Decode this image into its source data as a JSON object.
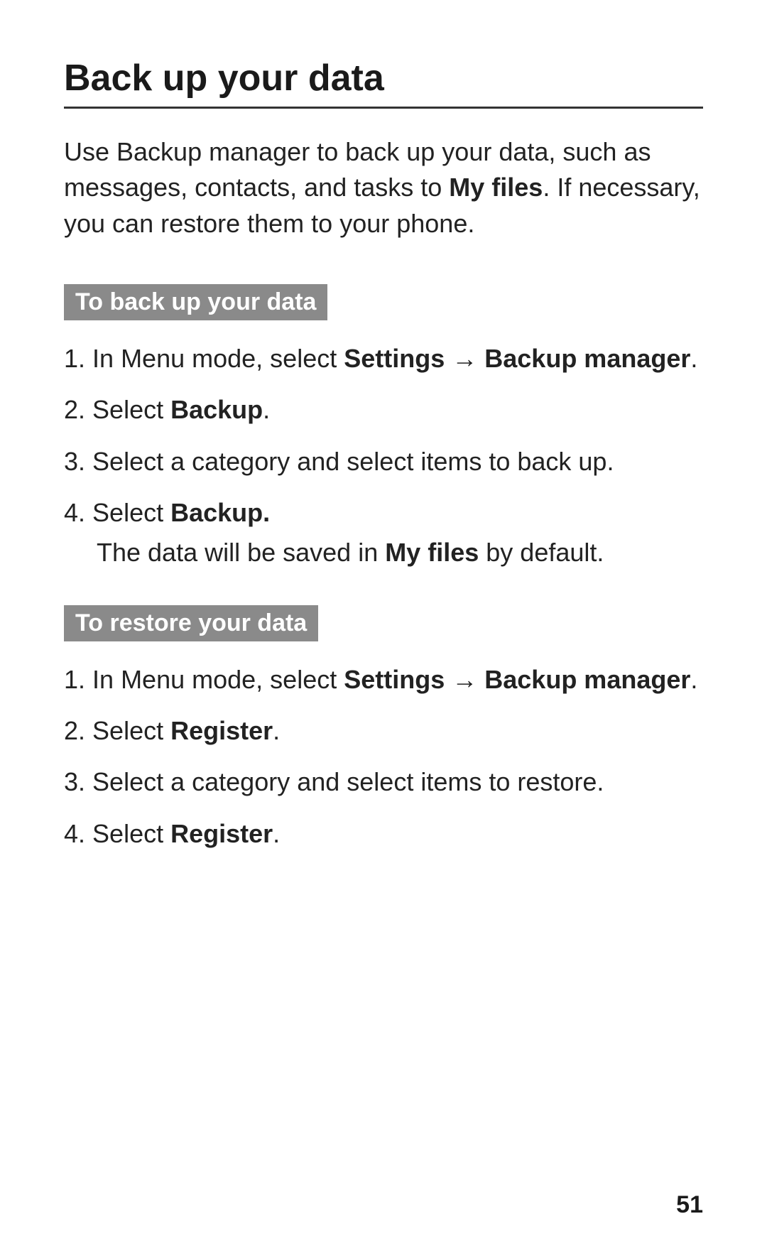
{
  "title": "Back up your data",
  "intro": {
    "part1": "Use Backup manager to back up your data, such as messages, contacts, and tasks to ",
    "bold1": "My files",
    "part2": ". If necessary, you can restore them to your phone."
  },
  "section1": {
    "label": "To back up your data",
    "steps": {
      "s1a": "In Menu mode, select ",
      "s1b": "Settings",
      "s1arrow": " → ",
      "s1c": "Backup manager",
      "s1d": ".",
      "s2a": "Select ",
      "s2b": "Backup",
      "s2c": ".",
      "s3": "Select a category and select items to back up.",
      "s4a": "Select ",
      "s4b": "Backup.",
      "s4sub_a": "The data will be saved in ",
      "s4sub_b": "My files",
      "s4sub_c": " by default."
    }
  },
  "section2": {
    "label": "To restore your data",
    "steps": {
      "s1a": "In Menu mode, select ",
      "s1b": "Settings",
      "s1arrow": " → ",
      "s1c": "Backup manager",
      "s1d": ".",
      "s2a": "Select ",
      "s2b": "Register",
      "s2c": ".",
      "s3": "Select a category and select items to restore.",
      "s4a": "Select ",
      "s4b": "Register",
      "s4c": "."
    }
  },
  "pageNumber": "51"
}
